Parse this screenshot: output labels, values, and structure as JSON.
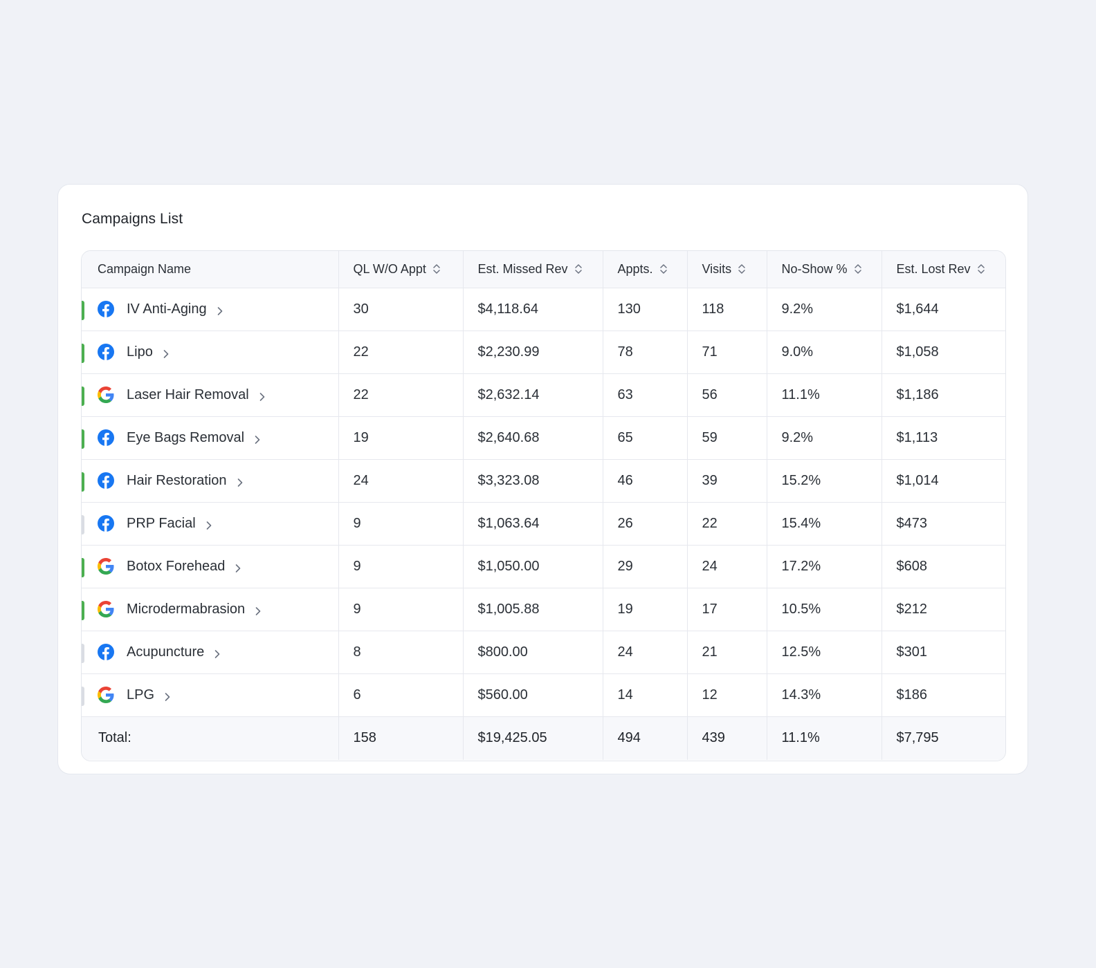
{
  "card": {
    "title": "Campaigns List"
  },
  "table": {
    "headers": [
      {
        "label": "Campaign Name",
        "sortable": false
      },
      {
        "label": "QL W/O Appt",
        "sortable": true
      },
      {
        "label": "Est. Missed Rev",
        "sortable": true
      },
      {
        "label": "Appts.",
        "sortable": true
      },
      {
        "label": "Visits",
        "sortable": true
      },
      {
        "label": "No-Show %",
        "sortable": true
      },
      {
        "label": "Est. Lost Rev",
        "sortable": true
      }
    ],
    "rows": [
      {
        "name": "IV Anti-Aging",
        "source": "facebook-icon",
        "status": "active",
        "ql": "30",
        "missed": "$4,118.64",
        "appts": "130",
        "visits": "118",
        "noshow": "9.2%",
        "lost": "$1,644"
      },
      {
        "name": "Lipo",
        "source": "facebook-icon",
        "status": "active",
        "ql": "22",
        "missed": "$2,230.99",
        "appts": "78",
        "visits": "71",
        "noshow": "9.0%",
        "lost": "$1,058"
      },
      {
        "name": "Laser Hair Removal",
        "source": "google-icon",
        "status": "active",
        "ql": "22",
        "missed": "$2,632.14",
        "appts": "63",
        "visits": "56",
        "noshow": "11.1%",
        "lost": "$1,186"
      },
      {
        "name": "Eye Bags Removal",
        "source": "facebook-icon",
        "status": "active",
        "ql": "19",
        "missed": "$2,640.68",
        "appts": "65",
        "visits": "59",
        "noshow": "9.2%",
        "lost": "$1,113"
      },
      {
        "name": "Hair Restoration",
        "source": "facebook-icon",
        "status": "active",
        "ql": "24",
        "missed": "$3,323.08",
        "appts": "46",
        "visits": "39",
        "noshow": "15.2%",
        "lost": "$1,014"
      },
      {
        "name": "PRP Facial",
        "source": "facebook-icon",
        "status": "inactive",
        "ql": "9",
        "missed": "$1,063.64",
        "appts": "26",
        "visits": "22",
        "noshow": "15.4%",
        "lost": "$473"
      },
      {
        "name": "Botox Forehead",
        "source": "google-icon",
        "status": "active",
        "ql": "9",
        "missed": "$1,050.00",
        "appts": "29",
        "visits": "24",
        "noshow": "17.2%",
        "lost": "$608"
      },
      {
        "name": "Microdermabrasion",
        "source": "google-icon",
        "status": "active",
        "ql": "9",
        "missed": "$1,005.88",
        "appts": "19",
        "visits": "17",
        "noshow": "10.5%",
        "lost": "$212"
      },
      {
        "name": "Acupuncture",
        "source": "facebook-icon",
        "status": "inactive",
        "ql": "8",
        "missed": "$800.00",
        "appts": "24",
        "visits": "21",
        "noshow": "12.5%",
        "lost": "$301"
      },
      {
        "name": "LPG",
        "source": "google-icon",
        "status": "inactive",
        "ql": "6",
        "missed": "$560.00",
        "appts": "14",
        "visits": "12",
        "noshow": "14.3%",
        "lost": "$186"
      }
    ],
    "totals": {
      "label": "Total:",
      "ql": "158",
      "missed": "$19,425.05",
      "appts": "494",
      "visits": "439",
      "noshow": "11.1%",
      "lost": "$7,795"
    }
  },
  "colors": {
    "page_background": "#f0f2f7",
    "status_active": "#4caf50",
    "status_inactive": "#dadde3",
    "facebook_blue": "#1877f2"
  }
}
